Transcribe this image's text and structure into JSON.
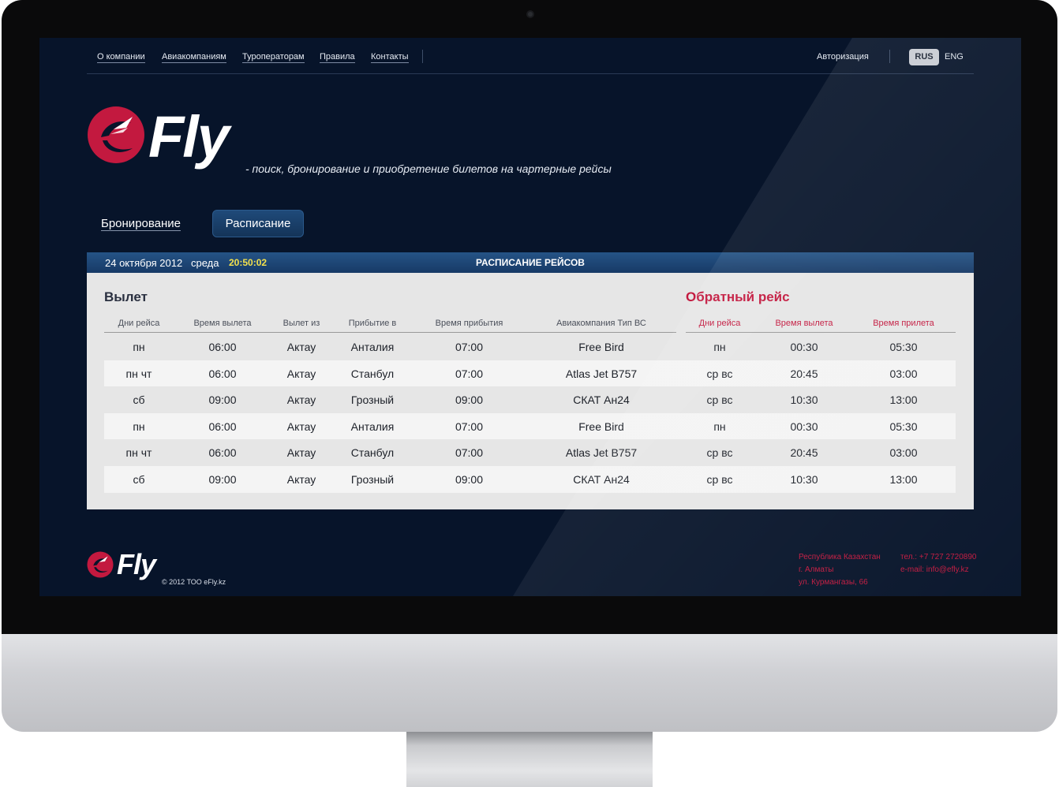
{
  "nav": {
    "links": [
      "О компании",
      "Авиакомпаниям",
      "Туроператорам",
      "Правила",
      "Контакты"
    ],
    "auth": "Авторизация",
    "lang_active": "RUS",
    "lang_other": "ENG"
  },
  "brand": {
    "name": "Fly",
    "tagline": "- поиск, бронирование и приобретение билетов на чартерные рейсы"
  },
  "tabs": {
    "booking": "Бронирование",
    "schedule": "Расписание"
  },
  "schedule_bar": {
    "date": "24 октября 2012",
    "day": "среда",
    "time": "20:50:02",
    "title": "РАСПИСАНИЕ РЕЙСОВ"
  },
  "departure": {
    "title": "Вылет",
    "headers": [
      "Дни рейса",
      "Время вылета",
      "Вылет из",
      "Прибытие в",
      "Время прибытия",
      "Авиакомпания Тип ВС"
    ]
  },
  "return": {
    "title": "Обратный рейс",
    "headers": [
      "Дни рейса",
      "Время вылета",
      "Время прилета"
    ]
  },
  "rows": [
    [
      "пн",
      "06:00",
      "Актау",
      "Анталия",
      "07:00",
      "Free Bird",
      "пн",
      "00:30",
      "05:30"
    ],
    [
      "пн чт",
      "06:00",
      "Актау",
      "Станбул",
      "07:00",
      "Atlas Jet B757",
      "ср вс",
      "20:45",
      "03:00"
    ],
    [
      "сб",
      "09:00",
      "Актау",
      "Грозный",
      "09:00",
      "СКАТ Ан24",
      "ср вс",
      "10:30",
      "13:00"
    ],
    [
      "пн",
      "06:00",
      "Актау",
      "Анталия",
      "07:00",
      "Free Bird",
      "пн",
      "00:30",
      "05:30"
    ],
    [
      "пн чт",
      "06:00",
      "Актау",
      "Станбул",
      "07:00",
      "Atlas Jet B757",
      "ср вс",
      "20:45",
      "03:00"
    ],
    [
      "сб",
      "09:00",
      "Актау",
      "Грозный",
      "09:00",
      "СКАТ Ан24",
      "ср вс",
      "10:30",
      "13:00"
    ]
  ],
  "footer": {
    "brand": "Fly",
    "copyright": "© 2012 ТОО eFly.kz",
    "address": [
      "Республика Казахстан",
      "г. Алматы",
      "ул. Курмангазы, 66"
    ],
    "contacts": [
      "тел.: +7 727 2720890",
      "e-mail: info@efly.kz"
    ]
  },
  "colors": {
    "accent_red": "#c3193f",
    "screen_bg": "#07142a",
    "clock_yellow": "#f4e14c"
  }
}
